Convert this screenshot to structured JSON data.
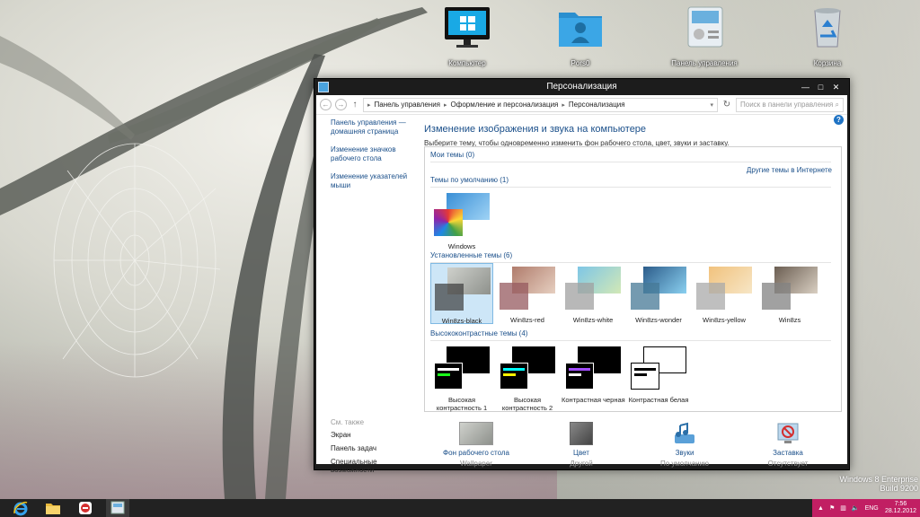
{
  "desktop": {
    "icons": [
      {
        "label": "Компьютер",
        "icon": "monitor-icon"
      },
      {
        "label": "Pors0",
        "icon": "user-folder-icon"
      },
      {
        "label": "Панель управления",
        "icon": "control-panel-icon"
      },
      {
        "label": "Корзина",
        "icon": "recycle-bin-icon"
      }
    ],
    "watermark": {
      "line1": "Windows 8 Enterprise",
      "line2": "Build 9200"
    }
  },
  "window": {
    "title": "Персонализация",
    "controls": [
      "—",
      "□",
      "✕"
    ],
    "address": {
      "crumbs": [
        "Панель управления",
        "Оформление и персонализация",
        "Персонализация"
      ],
      "search_placeholder": "Поиск в панели управления"
    },
    "sidebar": {
      "links": [
        "Панель управления — домашняя страница",
        "Изменение значков рабочего стола",
        "Изменение указателей мыши"
      ],
      "see_also_label": "См. также",
      "see_also": [
        "Экран",
        "Панель задач",
        "Специальные возможности"
      ]
    },
    "main": {
      "title": "Изменение изображения и звука на компьютере",
      "description": "Выберите тему, чтобы одновременно изменить фон рабочего стола, цвет, звуки и заставку.",
      "my_themes": "Мои темы (0)",
      "online_link": "Другие темы в Интернете",
      "default_themes": "Темы по умолчанию (1)",
      "default_items": [
        {
          "name": "Windows"
        }
      ],
      "installed_themes": "Установленные темы (6)",
      "installed_items": [
        {
          "name": "Win8zs-black",
          "selected": true
        },
        {
          "name": "Win8zs-red"
        },
        {
          "name": "Win8zs-white"
        },
        {
          "name": "Win8zs-wonder"
        },
        {
          "name": "Win8zs-yellow"
        },
        {
          "name": "Win8zs"
        }
      ],
      "hc_themes": "Высококонтрастные темы (4)",
      "hc_items": [
        {
          "name": "Высокая контрастность 1"
        },
        {
          "name": "Высокая контрастность 2"
        },
        {
          "name": "Контрастная черная"
        },
        {
          "name": "Контрастная белая"
        }
      ]
    },
    "bottom": [
      {
        "title": "Фон рабочего стола",
        "sub": "Wallpaper"
      },
      {
        "title": "Цвет",
        "sub": "Другой"
      },
      {
        "title": "Звуки",
        "sub": "По умолчанию"
      },
      {
        "title": "Заставка",
        "sub": "Отсутствует"
      }
    ]
  },
  "taskbar": {
    "apps": [
      "internet-explorer-icon",
      "file-explorer-icon",
      "app-icon",
      "control-panel-icon"
    ],
    "tray": {
      "lang": "ENG",
      "time": "7:56",
      "date": "28.12.2012"
    }
  },
  "colors": {
    "accent": "#1a4f8a",
    "tray": "#c11f63",
    "selection": "#cde6f7"
  }
}
